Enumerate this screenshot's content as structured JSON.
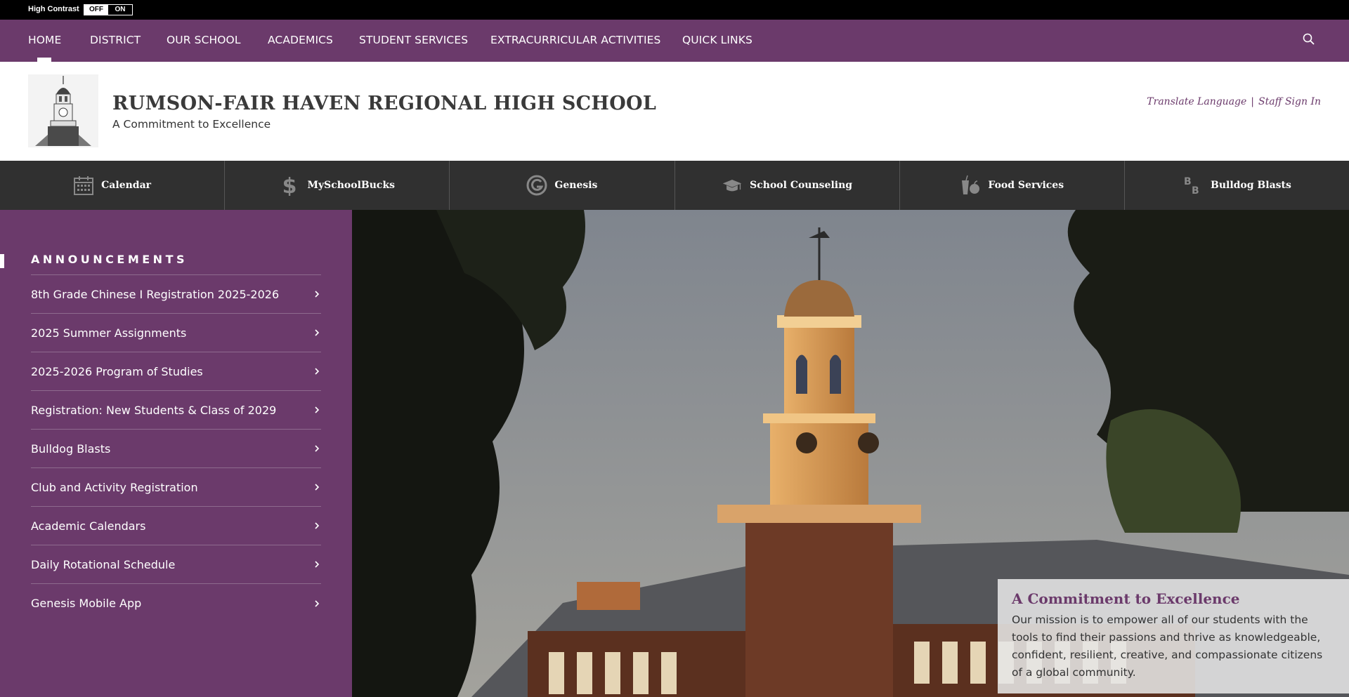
{
  "topbar": {
    "high_contrast_label": "High Contrast",
    "toggle_off": "OFF",
    "toggle_on": "ON"
  },
  "nav": {
    "items": [
      "HOME",
      "DISTRICT",
      "OUR SCHOOL",
      "ACADEMICS",
      "STUDENT SERVICES",
      "EXTRACURRICULAR ACTIVITIES",
      "QUICK LINKS"
    ],
    "active": "HOME",
    "search_icon": "search-icon"
  },
  "header": {
    "school_name": "RUMSON-FAIR HAVEN REGIONAL HIGH SCHOOL",
    "tagline": "A Commitment to Excellence",
    "translate_link": "Translate Language",
    "separator": "|",
    "staff_link": "Staff Sign In"
  },
  "quick_links": [
    {
      "label": "Calendar",
      "icon": "calendar-icon"
    },
    {
      "label": "MySchoolBucks",
      "icon": "dollar-icon"
    },
    {
      "label": "Genesis",
      "icon": "genesis-icon"
    },
    {
      "label": "School Counseling",
      "icon": "graduation-cap-icon"
    },
    {
      "label": "Food Services",
      "icon": "food-icon"
    },
    {
      "label": "Bulldog Blasts",
      "icon": "bb-icon"
    }
  ],
  "announcements": {
    "title": "ANNOUNCEMENTS",
    "items": [
      "8th Grade Chinese I Registration 2025-2026",
      "2025 Summer Assignments",
      "2025-2026 Program of Studies",
      "Registration: New Students & Class of 2029",
      "Bulldog Blasts",
      "Club and Activity Registration",
      "Academic Calendars",
      "Daily Rotational Schedule",
      "Genesis Mobile App"
    ]
  },
  "hero": {
    "caption_title": "A Commitment to Excellence",
    "caption_text": "Our mission is to empower all of our students with the tools to find their passions and thrive as knowledgeable, confident, resilient, creative, and compassionate citizens of a global community."
  },
  "colors": {
    "brand": "#6b3a6b",
    "dark_bar": "#303030",
    "topbar": "#000000"
  }
}
